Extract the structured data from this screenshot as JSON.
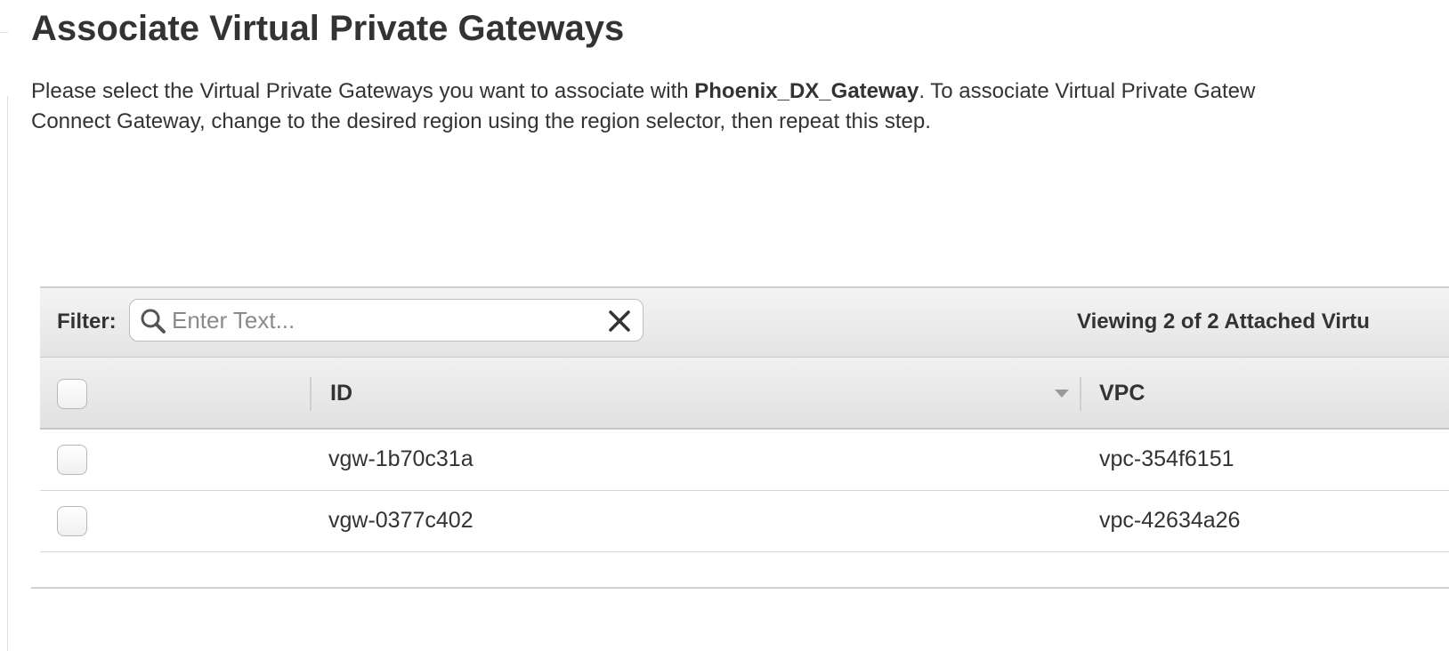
{
  "page": {
    "title": "Associate Virtual Private Gateways",
    "description": {
      "prefix": "Please select the Virtual Private Gateways you want to associate with ",
      "gateway_name": "Phoenix_DX_Gateway",
      "suffix_line1": ". To associate Virtual Private Gatew",
      "line2": "Connect Gateway, change to the desired region using the region selector, then repeat this step."
    }
  },
  "filter": {
    "label": "Filter:",
    "placeholder": "Enter Text...",
    "value": "",
    "viewing_text": "Viewing 2 of 2 Attached Virtu"
  },
  "table": {
    "columns": [
      {
        "label": "ID",
        "sortable": true
      },
      {
        "label": "VPC"
      }
    ],
    "rows": [
      {
        "id": "vgw-1b70c31a",
        "vpc": "vpc-354f6151",
        "selected": false
      },
      {
        "id": "vgw-0377c402",
        "vpc": "vpc-42634a26",
        "selected": false
      }
    ]
  },
  "icons": {
    "search": "search-icon",
    "clear": "close-icon",
    "sort": "sort-caret-down-icon"
  },
  "colors": {
    "text": "#333333",
    "header_bg": "#e8e8e8",
    "border": "#c8c8c8"
  }
}
